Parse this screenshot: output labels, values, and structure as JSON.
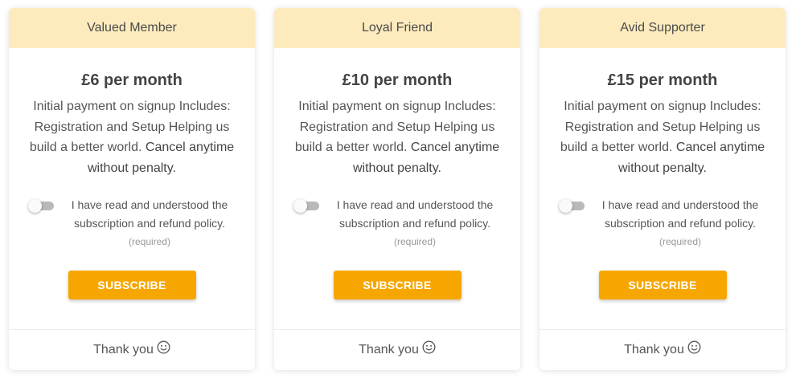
{
  "plans": [
    {
      "header": "Valued Member",
      "price": "£6 per month",
      "desc_part1": "Initial payment on signup Includes: Registration and Setup Helping us build a better world.",
      "desc_part2": "Cancel anytime without penalty.",
      "agree_text": "I have read and understood the subscription and refund policy.",
      "required_text": "(required)",
      "subscribe_label": "SUBSCRIBE",
      "footer_text": "Thank you"
    },
    {
      "header": "Loyal Friend",
      "price": "£10 per month",
      "desc_part1": "Initial payment on signup Includes: Registration and Setup Helping us build a better world.",
      "desc_part2": "Cancel anytime without penalty.",
      "agree_text": "I have read and understood the subscription and refund policy.",
      "required_text": "(required)",
      "subscribe_label": "SUBSCRIBE",
      "footer_text": "Thank you"
    },
    {
      "header": "Avid Supporter",
      "price": "£15 per month",
      "desc_part1": "Initial payment on signup Includes: Registration and Setup Helping us build a better world.",
      "desc_part2": "Cancel anytime without penalty.",
      "agree_text": "I have read and understood the subscription and refund policy.",
      "required_text": "(required)",
      "subscribe_label": "SUBSCRIBE",
      "footer_text": "Thank you"
    }
  ],
  "colors": {
    "header_bg": "#fdebbd",
    "button_bg": "#f7a600",
    "toggle_track": "#b9b9b9"
  },
  "icons": {
    "footer": "smiley-icon",
    "toggle": "toggle-switch"
  }
}
